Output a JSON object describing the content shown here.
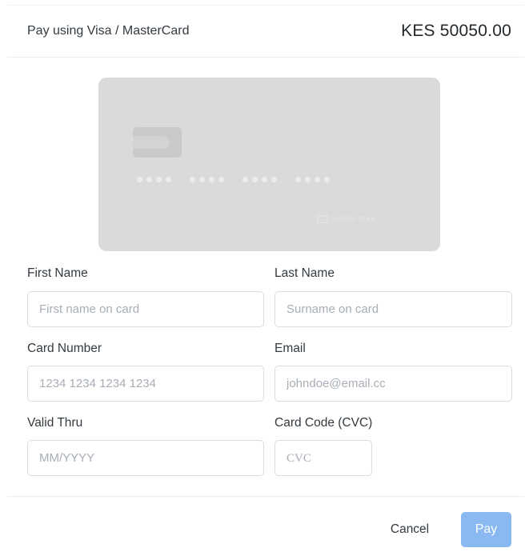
{
  "header": {
    "title": "Pay using Visa / MasterCard",
    "amount": "KES 50050.00"
  },
  "card_preview": {
    "number_mask": [
      "••••",
      "••••",
      "••••",
      "••••"
    ],
    "brand_text": "NORTH STAR"
  },
  "form": {
    "first_name": {
      "label": "First Name",
      "placeholder": "First name on card",
      "value": ""
    },
    "last_name": {
      "label": "Last Name",
      "placeholder": "Surname on card",
      "value": ""
    },
    "card_number": {
      "label": "Card Number",
      "placeholder": "1234 1234 1234 1234",
      "value": ""
    },
    "email": {
      "label": "Email",
      "placeholder": "johndoe@email.cc",
      "value": ""
    },
    "valid_thru": {
      "label": "Valid Thru",
      "placeholder": "MM/YYYY",
      "value": ""
    },
    "cvc": {
      "label": "Card Code (CVC)",
      "placeholder": "CVC",
      "value": ""
    }
  },
  "footer": {
    "cancel_label": "Cancel",
    "pay_label": "Pay"
  },
  "colors": {
    "pay_button": "#8ab8f1",
    "card_preview": "#dadada"
  }
}
